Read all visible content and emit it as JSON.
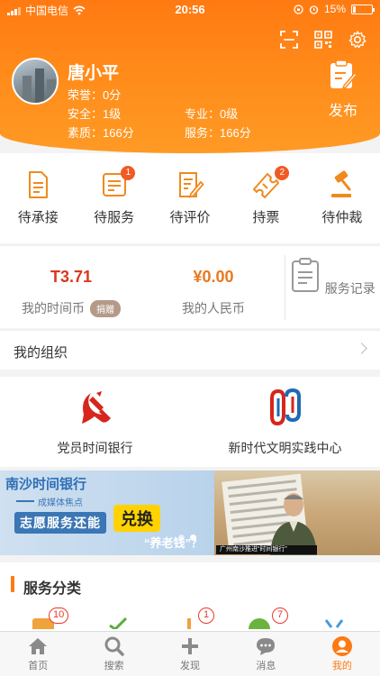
{
  "status_bar": {
    "carrier": "中国电信",
    "time": "20:56",
    "battery": "15%",
    "battery_level": 0.15
  },
  "header_icons": [
    "scan-icon",
    "qr-code-icon",
    "settings-gear-icon"
  ],
  "profile": {
    "name": "唐小平",
    "honor": "荣誉：0分",
    "safety": "安全：1级",
    "quality": "素质：166分",
    "profession": "专业：0级",
    "service": "服务：166分"
  },
  "publish": {
    "label": "发布"
  },
  "orders": [
    {
      "label": "待承接",
      "icon": "document-icon",
      "badge": ""
    },
    {
      "label": "待服务",
      "icon": "clipboard-icon",
      "badge": "1"
    },
    {
      "label": "待评价",
      "icon": "edit-document-icon",
      "badge": ""
    },
    {
      "label": "持票",
      "icon": "ticket-icon",
      "badge": "2"
    },
    {
      "label": "待仲裁",
      "icon": "gavel-icon",
      "badge": ""
    }
  ],
  "wallet": {
    "time_coin_value": "T3.71",
    "time_coin_label": "我的时间币",
    "donate": "捐赠",
    "rmb_value": "¥0.00",
    "rmb_label": "我的人民币",
    "service_record": "服务记录"
  },
  "my_org": {
    "label": "我的组织"
  },
  "features": [
    {
      "label": "党员时间银行",
      "icon": "party-emblem-icon"
    },
    {
      "label": "新时代文明实践中心",
      "icon": "civilization-center-logo-icon"
    }
  ],
  "banner": {
    "title": "南沙时间银行",
    "subtitle": "成媒体焦点",
    "main": "志愿服务还能",
    "exchange": "兑换",
    "pension": "“养老钱”？",
    "caption": "广州南沙推进“时间银行”"
  },
  "service_category": {
    "title": "服务分类",
    "badges": [
      "10",
      "1",
      "7"
    ]
  },
  "tabs": [
    {
      "label": "首页",
      "icon": "home-icon"
    },
    {
      "label": "搜索",
      "icon": "search-icon"
    },
    {
      "label": "发现",
      "icon": "plus-icon"
    },
    {
      "label": "消息",
      "icon": "message-icon"
    },
    {
      "label": "我的",
      "icon": "profile-icon"
    }
  ],
  "colors": {
    "accent": "#ff7a12",
    "badge": "#f15a24",
    "time_coin": "#d9381e",
    "rmb": "#e8791f"
  }
}
